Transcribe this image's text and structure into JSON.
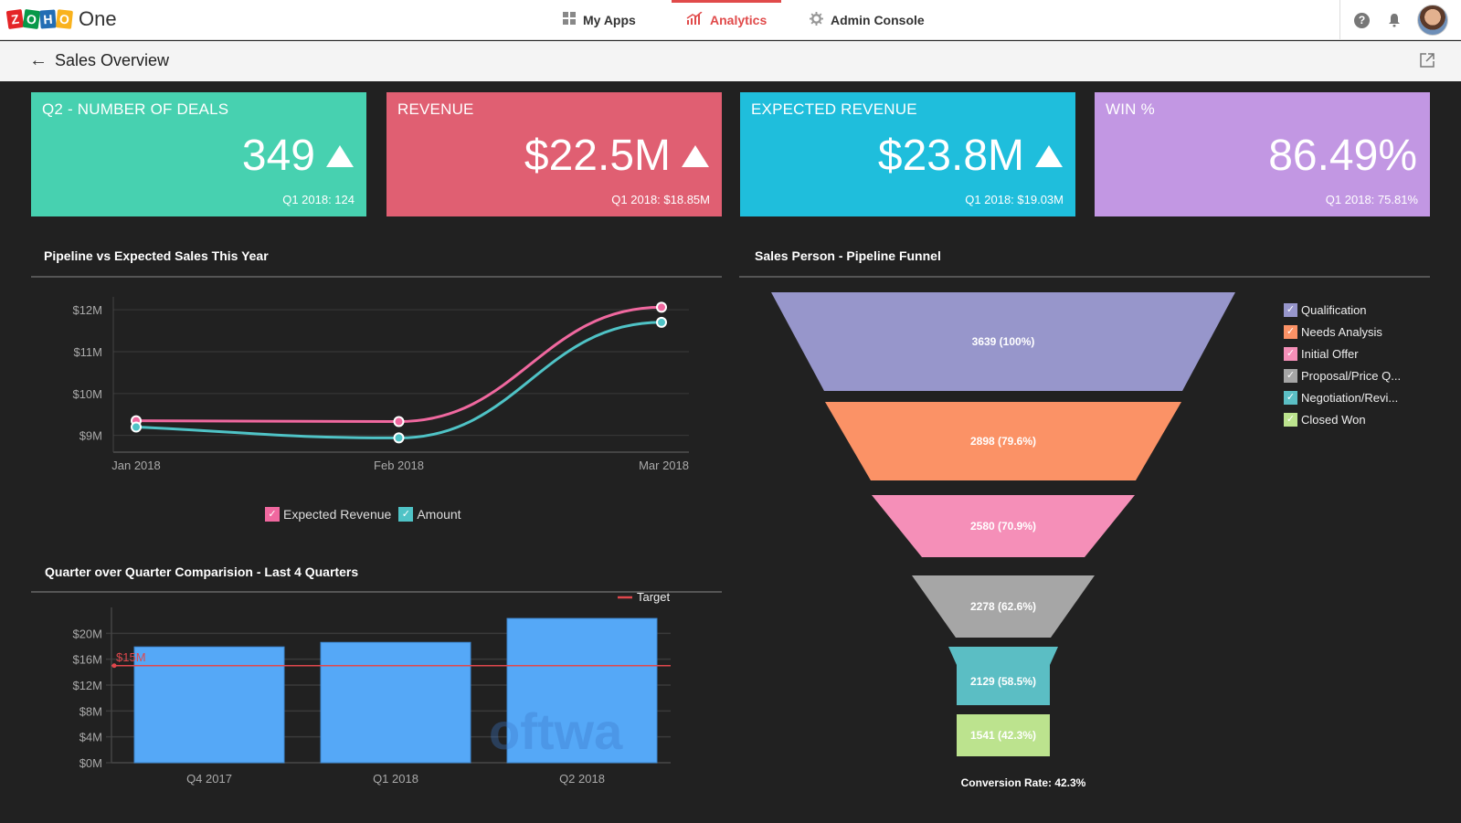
{
  "topbar": {
    "logo_letters": [
      "Z",
      "O",
      "H",
      "O"
    ],
    "logo_suffix": "One",
    "nav": [
      {
        "label": "My Apps",
        "icon": "grid-icon",
        "active": false
      },
      {
        "label": "Analytics",
        "icon": "analytics-icon",
        "active": true
      },
      {
        "label": "Admin Console",
        "icon": "gear-icon",
        "active": false
      }
    ],
    "help_glyph": "?",
    "accent_color": "#e04a4a"
  },
  "subbar": {
    "back_glyph": "←",
    "title": "Sales Overview"
  },
  "kpis": [
    {
      "label": "Q2 - NUMBER OF DEALS",
      "value": "349",
      "trend": "up",
      "previous": "Q1 2018: 124",
      "color": "#47d1b0"
    },
    {
      "label": "REVENUE",
      "value": "$22.5M",
      "trend": "up",
      "previous": "Q1 2018: $18.85M",
      "color": "#e05f72"
    },
    {
      "label": "EXPECTED REVENUE",
      "value": "$23.8M",
      "trend": "up",
      "previous": "Q1 2018: $19.03M",
      "color": "#1fbedc"
    },
    {
      "label": "WIN %",
      "value": "86.49%",
      "trend": "none",
      "previous": "Q1 2018: 75.81%",
      "color": "#c297e3"
    }
  ],
  "chart_data": [
    {
      "type": "line",
      "title": "Pipeline vs Expected Sales This Year",
      "x": [
        "Jan 2018",
        "Feb 2018",
        "Mar 2018"
      ],
      "y_ticks": [
        "$9M",
        "$10M",
        "$11M",
        "$12M"
      ],
      "y_tick_values": [
        9,
        10,
        11,
        12
      ],
      "ylim": [
        8.6,
        12.2
      ],
      "yunit": "$M",
      "grid": true,
      "legend_position": "bottom-center",
      "series": [
        {
          "name": "Expected Revenue",
          "values": [
            9.35,
            9.33,
            12.06
          ],
          "color": "#f0689f"
        },
        {
          "name": "Amount",
          "values": [
            9.2,
            8.94,
            11.7
          ],
          "color": "#4fc3c6"
        }
      ]
    },
    {
      "type": "bar",
      "title": "Quarter over Quarter Comparision - Last 4 Quarters",
      "categories": [
        "Q4 2017",
        "Q1 2018",
        "Q2 2018"
      ],
      "values": [
        17.9,
        18.6,
        22.3
      ],
      "bar_color": "#55a8f7",
      "y_ticks": [
        "$0M",
        "$4M",
        "$8M",
        "$12M",
        "$16M",
        "$20M"
      ],
      "y_tick_values": [
        0,
        4,
        8,
        12,
        16,
        20
      ],
      "ylim": [
        0,
        24
      ],
      "yunit": "$M",
      "grid": true,
      "target": {
        "name": "Target",
        "value": 15,
        "label": "$15M",
        "color": "#e0474c"
      },
      "legend_position": "top-right"
    },
    {
      "type": "funnel",
      "title": "Sales Person - Pipeline Funnel",
      "stages": [
        {
          "name": "Qualification",
          "display_name": "Qualification",
          "value": 3639,
          "percent": "100%",
          "color": "#9796cb"
        },
        {
          "name": "Needs Analysis",
          "display_name": "Needs Analysis",
          "value": 2898,
          "percent": "79.6%",
          "color": "#fb9266"
        },
        {
          "name": "Initial Offer",
          "display_name": "Initial Offer",
          "value": 2580,
          "percent": "70.9%",
          "color": "#f58fb8"
        },
        {
          "name": "Proposal/Price Quote",
          "display_name": "Proposal/Price Q...",
          "value": 2278,
          "percent": "62.6%",
          "color": "#a6a6a6"
        },
        {
          "name": "Negotiation/Review",
          "display_name": "Negotiation/Revi...",
          "value": 2129,
          "percent": "58.5%",
          "color": "#5bbec4"
        },
        {
          "name": "Closed Won",
          "display_name": "Closed Won",
          "value": 1541,
          "percent": "42.3%",
          "color": "#bce38e"
        }
      ],
      "legend_position": "right",
      "footer": "Conversion Rate: 42.3%"
    }
  ],
  "watermark": "oftwa"
}
